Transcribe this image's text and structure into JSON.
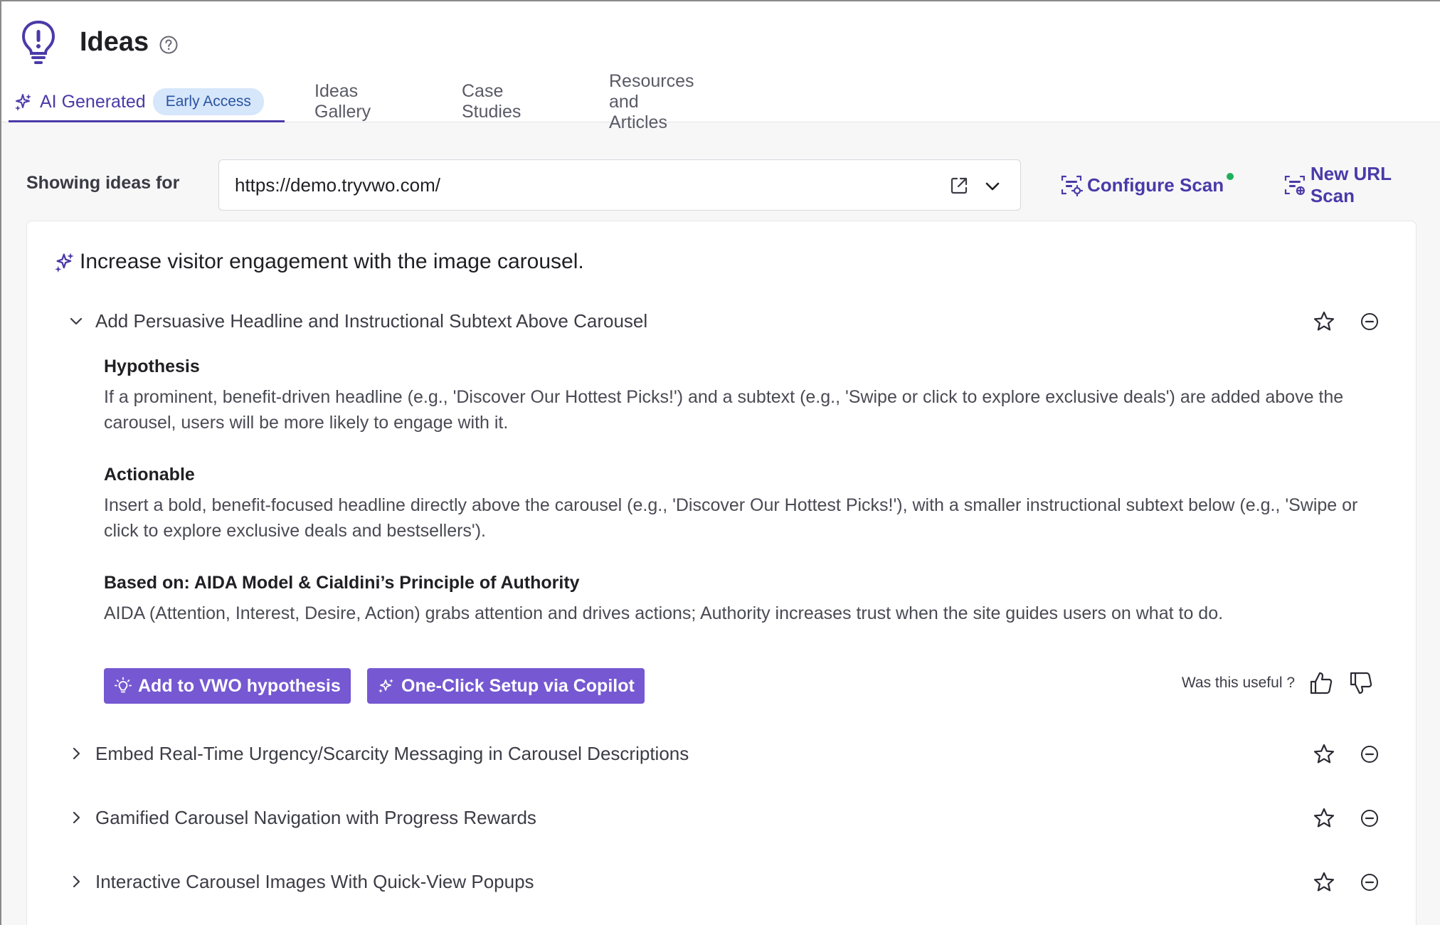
{
  "header": {
    "title": "Ideas",
    "icons": {
      "logo": "lightbulb-icon",
      "help": "help-circle-icon"
    }
  },
  "tabs": [
    {
      "label": "AI Generated",
      "badge": "Early Access",
      "active": true,
      "icon": "sparkle-icon"
    },
    {
      "label": "Ideas Gallery",
      "active": false
    },
    {
      "label": "Case Studies",
      "active": false
    },
    {
      "label": "Resources and Articles",
      "active": false
    }
  ],
  "filter": {
    "label": "Showing ideas for",
    "url": "https://demo.tryvwo.com/"
  },
  "actions": {
    "configure_scan": "Configure Scan",
    "new_url_scan": "New URL Scan"
  },
  "card": {
    "title": "Increase visitor engagement with the image carousel.",
    "ideas": [
      {
        "title": "Add Persuasive Headline and Instructional Subtext Above Carousel",
        "expanded": true,
        "hypothesis_title": "Hypothesis",
        "hypothesis": "If a prominent, benefit-driven headline (e.g., 'Discover Our Hottest Picks!') and a subtext (e.g., 'Swipe or click to explore exclusive deals') are added above the carousel, users will be more likely to engage with it.",
        "actionable_title": "Actionable",
        "actionable": "Insert a bold, benefit-focused headline directly above the carousel (e.g., 'Discover Our Hottest Picks!'), with a smaller instructional subtext below (e.g., 'Swipe or click to explore exclusive deals and bestsellers').",
        "based_on_title": "Based on: AIDA Model & Cialdini’s Principle of Authority",
        "based_on": "AIDA (Attention, Interest, Desire, Action) grabs attention and drives actions; Authority increases trust when the site guides users on what to do.",
        "add_button": "Add to VWO hypothesis",
        "copilot_button": "One-Click Setup via Copilot",
        "useful_prompt": "Was this useful ?"
      },
      {
        "title": "Embed Real-Time Urgency/Scarcity Messaging in Carousel Descriptions",
        "expanded": false
      },
      {
        "title": "Gamified Carousel Navigation with Progress Rewards",
        "expanded": false
      },
      {
        "title": "Interactive Carousel Images With Quick-View Popups",
        "expanded": false
      }
    ]
  },
  "colors": {
    "accent": "#4a3aa8",
    "button": "#7558d2",
    "badge_bg": "#d6e6fb",
    "status_dot": "#1fb05a"
  }
}
